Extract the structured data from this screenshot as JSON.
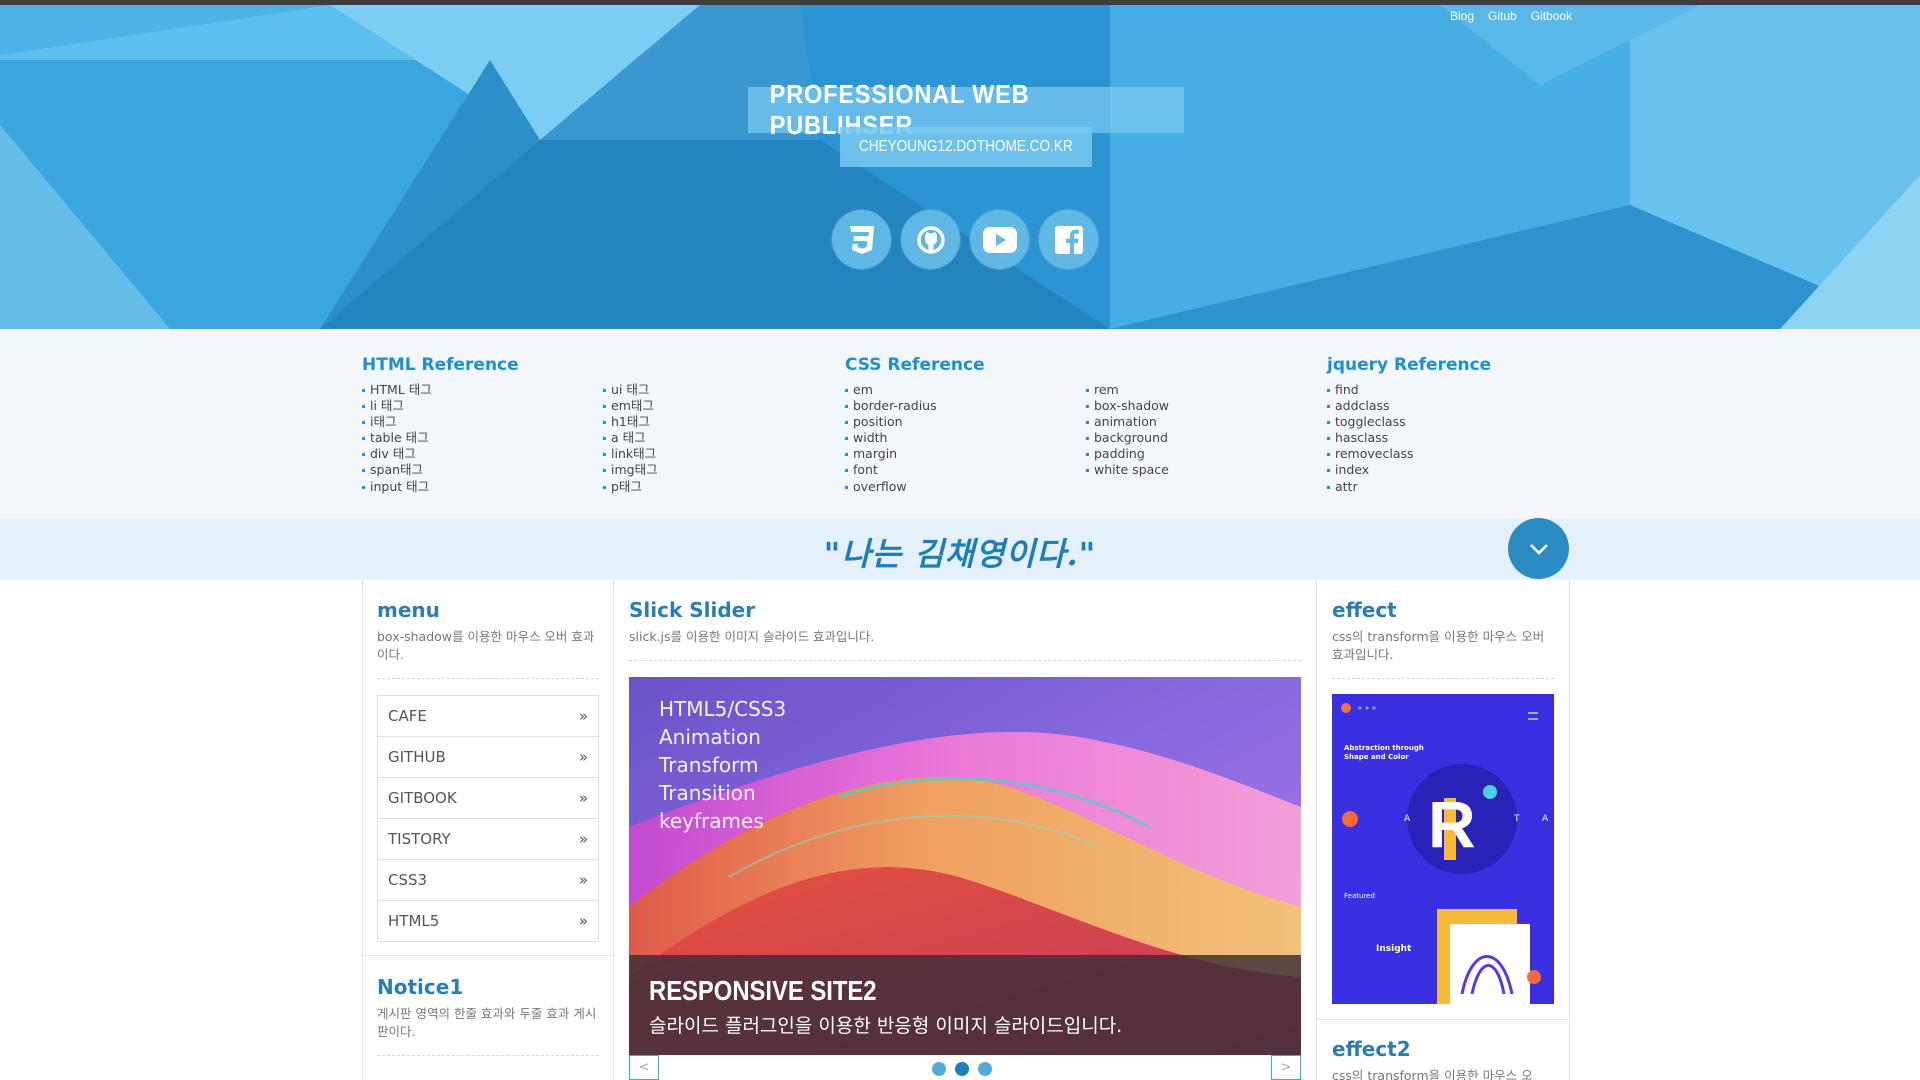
{
  "header": {
    "toplinks": [
      "Blog",
      "Gitub",
      "Gitbook"
    ],
    "title": "PROFESSIONAL WEB PUBLIHSER",
    "subtitle": "CHEYOUNG12.DOTHOME.CO.KR",
    "sns_icons": [
      "css3-icon",
      "github-icon",
      "youtube-icon",
      "facebook-icon"
    ]
  },
  "reference": {
    "html": {
      "title": "HTML Reference",
      "col1": [
        "HTML 태그",
        "li 태그",
        "i태그",
        "table 태그",
        "div 태그",
        "span태그",
        "input 태그"
      ],
      "col2": [
        "ui 태그",
        "em태그",
        "h1태그",
        "a 태그",
        "link태그",
        "img태그",
        "p태그"
      ]
    },
    "css": {
      "title": "CSS Reference",
      "col1": [
        "em",
        "border-radius",
        "position",
        "width",
        "margin",
        "font",
        "overflow"
      ],
      "col2": [
        "rem",
        "box-shadow",
        "animation",
        "background",
        "padding",
        "white space"
      ]
    },
    "jquery": {
      "title": "jquery Reference",
      "col1": [
        "find",
        "addclass",
        "toggleclass",
        "hasclass",
        "removeclass",
        "index",
        "attr"
      ]
    }
  },
  "quote": "\"나는 김채영이다.\"",
  "menu": {
    "title": "menu",
    "desc": "box-shadow를 이용한 마우스 오버 효과이다.",
    "items": [
      "CAFE",
      "GITHUB",
      "GITBOOK",
      "TISTORY",
      "CSS3",
      "HTML5"
    ],
    "arrow": "»"
  },
  "notice": {
    "title": "Notice1",
    "desc": "게시판 영역의 한줄 효과와 두줄 효과 게시판이다."
  },
  "slider": {
    "title": "Slick Slider",
    "desc": "slick.js를 이용한 이미지 슬라이드 효과입니다.",
    "slide_text": [
      "HTML5/CSS3",
      "Animation",
      "Transform",
      "Transition",
      "keyframes"
    ],
    "caption_title": "RESPONSIVE SITE2",
    "caption_desc": "슬라이드 플러그인을 이용한 반응형 이미지 슬라이드입니다.",
    "prev": "<",
    "next": ">",
    "active_dot": 1
  },
  "effect": {
    "title": "effect",
    "desc": "css의 transform을 이용한 마우스 오버효과입니다.",
    "card_heading": "Abstraction through Shape and Color",
    "card_letter": "R",
    "card_side": [
      "A",
      "T",
      "A"
    ],
    "card_featured": "Featured",
    "card_insight": "Insight"
  },
  "effect2": {
    "title": "effect2",
    "desc": "css의 transform을 이용한 마우스 오"
  },
  "colors": {
    "accent": "#1e8fcf",
    "header_bg": "#2e9bd6",
    "title_blue": "#2b7db3"
  }
}
